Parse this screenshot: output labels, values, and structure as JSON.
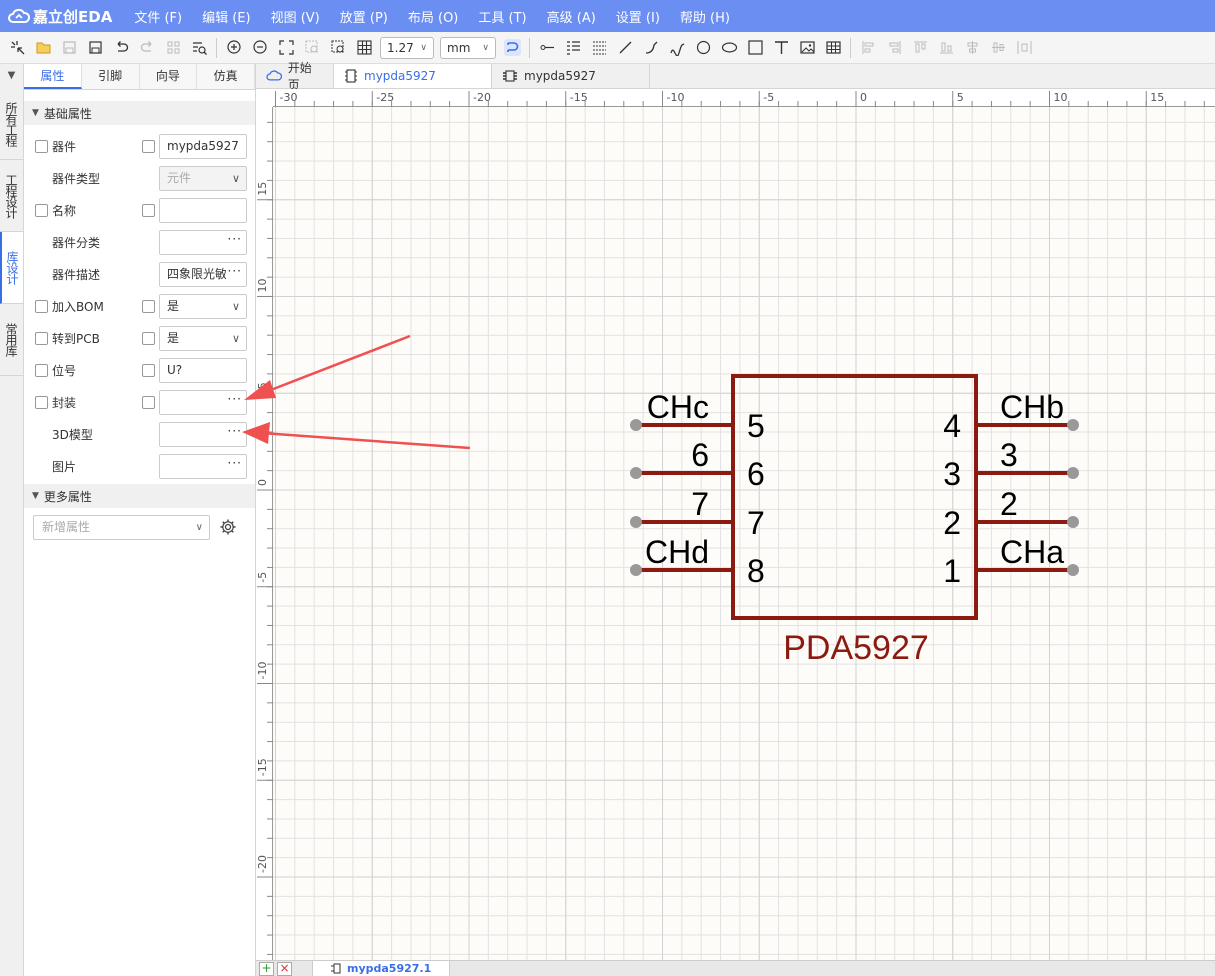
{
  "app": {
    "logo_text": "嘉立创EDA"
  },
  "menu": [
    "文件 (F)",
    "编辑 (E)",
    "视图 (V)",
    "放置 (P)",
    "布局 (O)",
    "工具 (T)",
    "高级 (A)",
    "设置 (I)",
    "帮助 (H)"
  ],
  "toolbar": {
    "grid_size": "1.27",
    "unit": "mm"
  },
  "vtabs": [
    "所有工程",
    "工程设计",
    "库设计",
    "常用库"
  ],
  "panel": {
    "tabs": [
      "属性",
      "引脚",
      "向导",
      "仿真"
    ],
    "basic_section": "基础属性",
    "more_section": "更多属性",
    "rows": {
      "device": {
        "label": "器件",
        "value": "mypda5927"
      },
      "device_type": {
        "label": "器件类型",
        "value": "元件"
      },
      "name": {
        "label": "名称",
        "value": ""
      },
      "category": {
        "label": "器件分类",
        "value": ""
      },
      "description": {
        "label": "器件描述",
        "value": "四象限光敏"
      },
      "bom": {
        "label": "加入BOM",
        "value": "是"
      },
      "to_pcb": {
        "label": "转到PCB",
        "value": "是"
      },
      "designator": {
        "label": "位号",
        "value": "U?"
      },
      "footprint": {
        "label": "封装",
        "value": ""
      },
      "model3d": {
        "label": "3D模型",
        "value": ""
      },
      "image": {
        "label": "图片",
        "value": ""
      }
    },
    "add_attr_placeholder": "新增属性"
  },
  "doc_tabs": [
    "开始页",
    "mypda5927",
    "mypda5927"
  ],
  "sheet_tab": "mypda5927.1",
  "ruler": {
    "top": [
      "-30",
      "-25",
      "-20",
      "-15",
      "-10",
      "-5",
      "0",
      "5",
      "10",
      "15"
    ],
    "left": [
      "15",
      "10",
      "5",
      "0",
      "-5",
      "-10",
      "-15",
      "-20"
    ]
  },
  "symbol": {
    "name": "PDA5927",
    "left_pins": [
      {
        "number": "5",
        "name": "CHc"
      },
      {
        "number": "6",
        "name": "6"
      },
      {
        "number": "7",
        "name": "7"
      },
      {
        "number": "8",
        "name": "CHd"
      }
    ],
    "right_pins": [
      {
        "number": "4",
        "name": "CHb"
      },
      {
        "number": "3",
        "name": "3"
      },
      {
        "number": "2",
        "name": "2"
      },
      {
        "number": "1",
        "name": "CHa"
      }
    ]
  },
  "colors": {
    "accent": "#6a8ef2",
    "symbol": "#8b1a10",
    "arrow": "#f05050"
  }
}
